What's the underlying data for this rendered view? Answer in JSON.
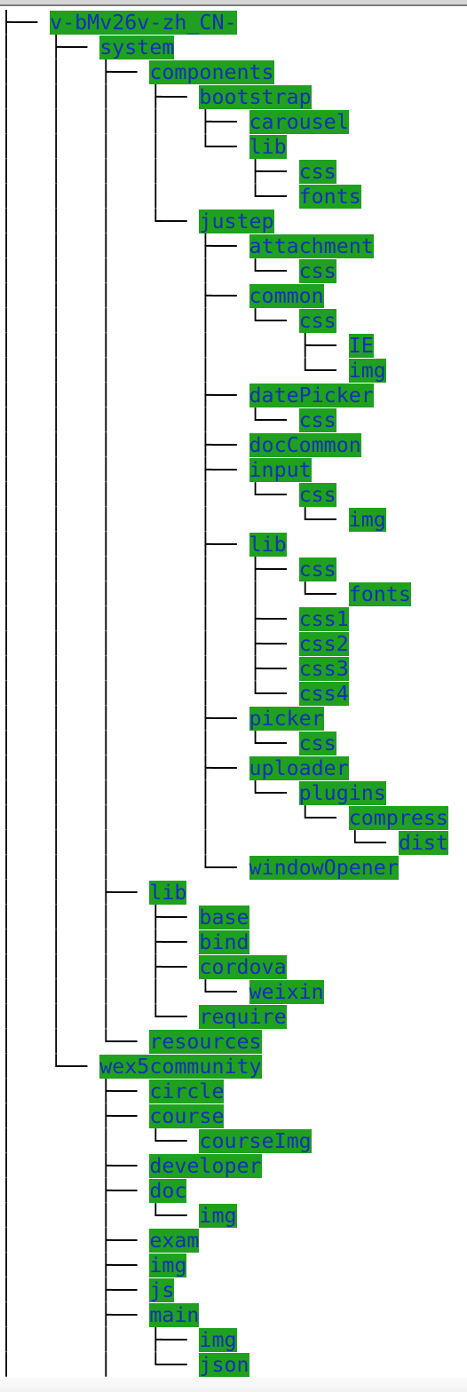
{
  "colors": {
    "highlight": "#1fa01f",
    "text": "#1530b8",
    "lines": "#000000"
  },
  "tree": [
    {
      "prefix": "├── ",
      "name": "v-bMv26v-zh_CN-"
    },
    {
      "prefix": "│   ├── ",
      "name": "system"
    },
    {
      "prefix": "│   │   ├── ",
      "name": "components"
    },
    {
      "prefix": "│   │   │   ├── ",
      "name": "bootstrap"
    },
    {
      "prefix": "│   │   │   │   ├── ",
      "name": "carousel"
    },
    {
      "prefix": "│   │   │   │   └── ",
      "name": "lib"
    },
    {
      "prefix": "│   │   │   │       ├── ",
      "name": "css"
    },
    {
      "prefix": "│   │   │   │       └── ",
      "name": "fonts"
    },
    {
      "prefix": "│   │   │   └── ",
      "name": "justep"
    },
    {
      "prefix": "│   │   │       ├── ",
      "name": "attachment"
    },
    {
      "prefix": "│   │   │       │   └── ",
      "name": "css"
    },
    {
      "prefix": "│   │   │       ├── ",
      "name": "common"
    },
    {
      "prefix": "│   │   │       │   └── ",
      "name": "css"
    },
    {
      "prefix": "│   │   │       │       ├── ",
      "name": "IE"
    },
    {
      "prefix": "│   │   │       │       └── ",
      "name": "img"
    },
    {
      "prefix": "│   │   │       ├── ",
      "name": "datePicker"
    },
    {
      "prefix": "│   │   │       │   └── ",
      "name": "css"
    },
    {
      "prefix": "│   │   │       ├── ",
      "name": "docCommon"
    },
    {
      "prefix": "│   │   │       ├── ",
      "name": "input"
    },
    {
      "prefix": "│   │   │       │   └── ",
      "name": "css"
    },
    {
      "prefix": "│   │   │       │       └── ",
      "name": "img"
    },
    {
      "prefix": "│   │   │       ├── ",
      "name": "lib"
    },
    {
      "prefix": "│   │   │       │   ├── ",
      "name": "css"
    },
    {
      "prefix": "│   │   │       │   │   └── ",
      "name": "fonts"
    },
    {
      "prefix": "│   │   │       │   ├── ",
      "name": "css1"
    },
    {
      "prefix": "│   │   │       │   ├── ",
      "name": "css2"
    },
    {
      "prefix": "│   │   │       │   ├── ",
      "name": "css3"
    },
    {
      "prefix": "│   │   │       │   └── ",
      "name": "css4"
    },
    {
      "prefix": "│   │   │       ├── ",
      "name": "picker"
    },
    {
      "prefix": "│   │   │       │   └── ",
      "name": "css"
    },
    {
      "prefix": "│   │   │       ├── ",
      "name": "uploader"
    },
    {
      "prefix": "│   │   │       │   └── ",
      "name": "plugins"
    },
    {
      "prefix": "│   │   │       │       └── ",
      "name": "compress"
    },
    {
      "prefix": "│   │   │       │           └── ",
      "name": "dist"
    },
    {
      "prefix": "│   │   │       └── ",
      "name": "windowOpener"
    },
    {
      "prefix": "│   │   ├── ",
      "name": "lib"
    },
    {
      "prefix": "│   │   │   ├── ",
      "name": "base"
    },
    {
      "prefix": "│   │   │   ├── ",
      "name": "bind"
    },
    {
      "prefix": "│   │   │   ├── ",
      "name": "cordova"
    },
    {
      "prefix": "│   │   │   │   └── ",
      "name": "weixin"
    },
    {
      "prefix": "│   │   │   └── ",
      "name": "require"
    },
    {
      "prefix": "│   │   └── ",
      "name": "resources"
    },
    {
      "prefix": "│   └── ",
      "name": "wex5community"
    },
    {
      "prefix": "│       ├── ",
      "name": "circle"
    },
    {
      "prefix": "│       ├── ",
      "name": "course"
    },
    {
      "prefix": "│       │   └── ",
      "name": "courseImg"
    },
    {
      "prefix": "│       ├── ",
      "name": "developer"
    },
    {
      "prefix": "│       ├── ",
      "name": "doc"
    },
    {
      "prefix": "│       │   └── ",
      "name": "img"
    },
    {
      "prefix": "│       ├── ",
      "name": "exam"
    },
    {
      "prefix": "│       ├── ",
      "name": "img"
    },
    {
      "prefix": "│       ├── ",
      "name": "js"
    },
    {
      "prefix": "│       ├── ",
      "name": "main"
    },
    {
      "prefix": "│       │   ├── ",
      "name": "img"
    },
    {
      "prefix": "│       │   └── ",
      "name": "json"
    }
  ]
}
